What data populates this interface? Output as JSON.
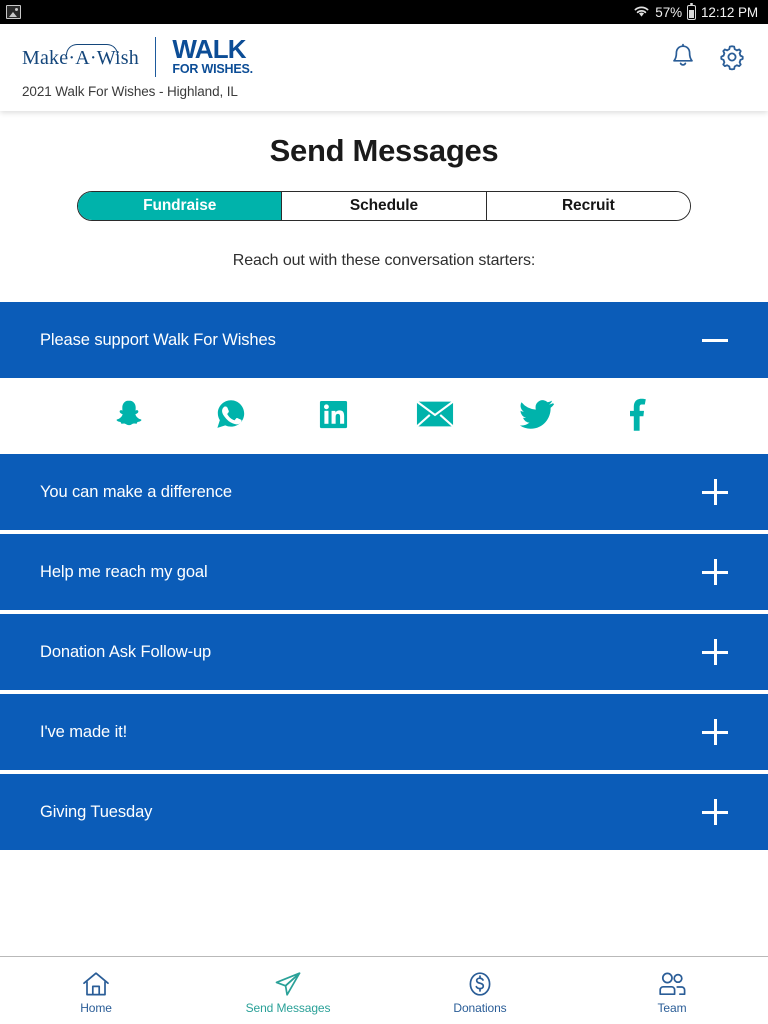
{
  "status_bar": {
    "left_icon": "image-notification-icon",
    "wifi_icon": "wifi-icon",
    "battery_percent": "57%",
    "battery_icon": "battery-icon",
    "time": "12:12 PM"
  },
  "header": {
    "brand_primary": "Make·A·Wish",
    "brand_primary_line": "Make",
    "brand_primary_mid": "A",
    "brand_primary_end": "Wish",
    "brand_secondary_top": "WALK",
    "brand_secondary_bottom": "FOR WISHES.",
    "event_name": "2021 Walk For Wishes - Highland, IL",
    "notifications_icon": "bell-icon",
    "settings_icon": "gear-icon"
  },
  "main": {
    "page_title": "Send Messages",
    "subhead": "Reach out with these conversation starters:",
    "tabs": [
      {
        "label": "Fundraise",
        "active": true
      },
      {
        "label": "Schedule",
        "active": false
      },
      {
        "label": "Recruit",
        "active": false
      }
    ],
    "accordion": [
      {
        "title": "Please support Walk For Wishes",
        "expanded": true,
        "toggle": "minus"
      },
      {
        "title": "You can make a difference",
        "expanded": false,
        "toggle": "plus"
      },
      {
        "title": "Help me reach my goal",
        "expanded": false,
        "toggle": "plus"
      },
      {
        "title": "Donation Ask Follow-up",
        "expanded": false,
        "toggle": "plus"
      },
      {
        "title": "I've made it!",
        "expanded": false,
        "toggle": "plus"
      },
      {
        "title": "Giving Tuesday",
        "expanded": false,
        "toggle": "plus"
      }
    ],
    "share_options": [
      {
        "name": "snapchat-icon",
        "label": "Snapchat"
      },
      {
        "name": "whatsapp-icon",
        "label": "WhatsApp"
      },
      {
        "name": "linkedin-icon",
        "label": "LinkedIn"
      },
      {
        "name": "email-icon",
        "label": "Email"
      },
      {
        "name": "twitter-icon",
        "label": "Twitter"
      },
      {
        "name": "facebook-icon",
        "label": "Facebook"
      }
    ]
  },
  "bottom_nav": [
    {
      "label": "Home",
      "icon": "home-icon",
      "active": false
    },
    {
      "label": "Send Messages",
      "icon": "paper-plane-icon",
      "active": true
    },
    {
      "label": "Donations",
      "icon": "dollar-circle-icon",
      "active": false
    },
    {
      "label": "Team",
      "icon": "people-icon",
      "active": false
    }
  ],
  "colors": {
    "brand_blue": "#0b5cb8",
    "brand_navy": "#14467b",
    "teal": "#00b3ab",
    "nav_blue": "#2a5d97",
    "nav_active_teal": "#2aa198"
  }
}
